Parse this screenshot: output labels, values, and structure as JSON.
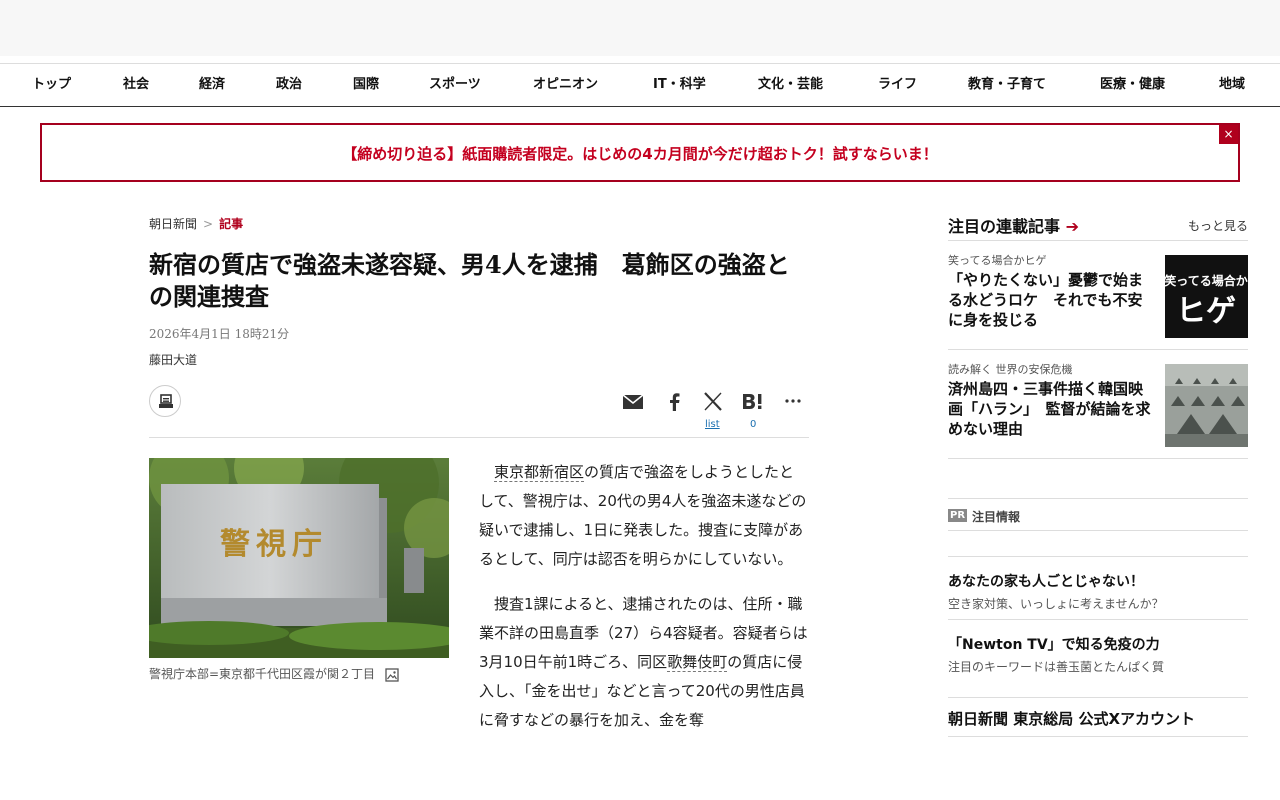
{
  "nav": {
    "items": [
      "トップ",
      "社会",
      "経済",
      "政治",
      "国際",
      "スポーツ",
      "オピニオン",
      "IT・科学",
      "文化・芸能",
      "ライフ",
      "教育・子育て",
      "医療・健康",
      "地域"
    ]
  },
  "promo": {
    "text": "【締め切り迫る】紙面購読者限定。はじめの4カ月間が今だけ超おトク！試すならいま！",
    "close": "×"
  },
  "breadcrumb": {
    "home": "朝日新聞",
    "separator": ">",
    "current": "記事"
  },
  "article": {
    "title": "新宿の質店で強盗未遂容疑、男4人を逮捕　葛飾区の強盗との関連捜査",
    "date": "2026年4月1日 18時21分",
    "author": "藤田大道",
    "share_counts": {
      "x": "list",
      "hatena": "0"
    },
    "photo_caption": "警視庁本部=東京都千代田区霞が関２丁目",
    "photo_sign": "警視庁",
    "paragraphs": [
      {
        "link": "東京都新宿区",
        "before": "",
        "after": "の質店で強盗をしようとしたとして、警視庁は、20代の男4人を強盗未遂などの疑いで逮捕し、1日に発表した。捜査に支障があるとして、同庁は認否を明らかにしていない。"
      },
      {
        "link": "歌舞伎町",
        "before": "捜査1課によると、逮捕されたのは、住所・職業不詳の田島直季（27）ら4容疑者。容疑者らは3月10日午前1時ごろ、同区",
        "after": "の質店に侵入し、「金を出せ」などと言って20代の男性店員に脅すなどの暴行を加え、金を奪"
      }
    ]
  },
  "sidebar": {
    "head_title": "注目の連載記事",
    "head_arrow": "➔",
    "more": "もっと見る",
    "cards": [
      {
        "kicker": "笑ってる場合かヒゲ",
        "title": "「やりたくない」憂鬱で始まる水どうロケ　それでも不安に身を投じる",
        "thumb_text_small": "笑ってる場合か",
        "thumb_text_big": "ヒゲ"
      },
      {
        "kicker": "読み解く 世界の安保危機",
        "title": "済州島四・三事件描く韓国映画「ハラン」　監督が結論を求めない理由"
      }
    ]
  },
  "pr": {
    "badge": "PR",
    "label": "注目情報",
    "items": [
      {
        "title": "あなたの家も人ごとじゃない！",
        "sub": "空き家対策、いっしょに考えませんか？"
      },
      {
        "title": "「Newton TV」で知る免疫の力",
        "sub": "注目のキーワードは善玉菌とたんぱく質"
      }
    ]
  },
  "x_account": {
    "title": "朝日新聞 東京総局 公式Xアカウント"
  },
  "colors": {
    "accent": "#b0001d",
    "promo_border": "#a5001e",
    "link": "#1a6fb0"
  }
}
